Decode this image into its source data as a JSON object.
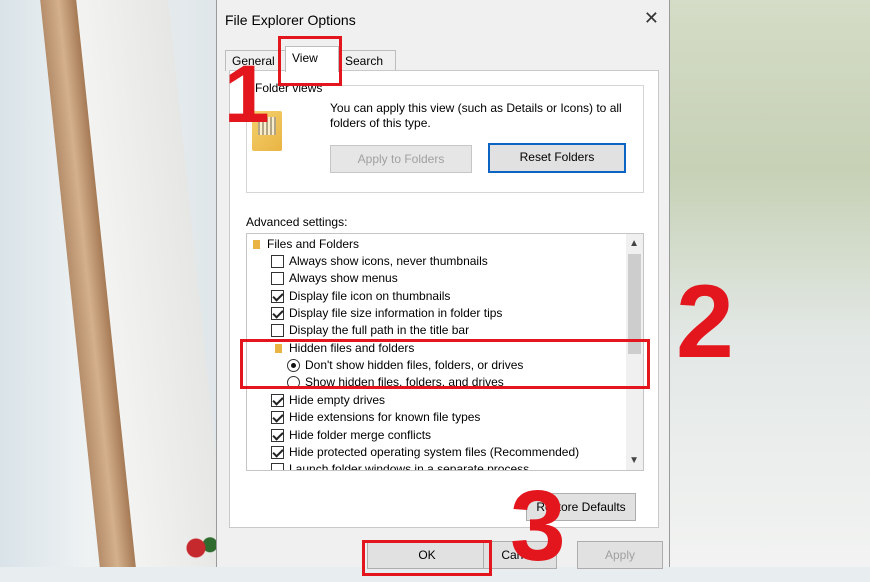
{
  "window": {
    "title": "File Explorer Options",
    "close_symbol": "✕"
  },
  "tabs": [
    {
      "label": "General"
    },
    {
      "label": "View"
    },
    {
      "label": "Search"
    }
  ],
  "folder_views": {
    "heading": "Folder views",
    "description": "You can apply this view (such as Details or Icons) to all folders of this type.",
    "apply_button": "Apply to Folders",
    "reset_button": "Reset Folders"
  },
  "advanced": {
    "heading": "Advanced settings:",
    "items": [
      {
        "type": "folder",
        "label": "Files and Folders"
      },
      {
        "type": "checkbox",
        "checked": false,
        "label": "Always show icons, never thumbnails"
      },
      {
        "type": "checkbox",
        "checked": false,
        "label": "Always show menus"
      },
      {
        "type": "checkbox",
        "checked": true,
        "label": "Display file icon on thumbnails"
      },
      {
        "type": "checkbox",
        "checked": true,
        "label": "Display file size information in folder tips"
      },
      {
        "type": "checkbox",
        "checked": false,
        "label": "Display the full path in the title bar"
      },
      {
        "type": "folder",
        "label": "Hidden files and folders"
      },
      {
        "type": "radio",
        "checked": true,
        "label": "Don't show hidden files, folders, or drives"
      },
      {
        "type": "radio",
        "checked": false,
        "label": "Show hidden files, folders, and drives"
      },
      {
        "type": "checkbox",
        "checked": true,
        "label": "Hide empty drives"
      },
      {
        "type": "checkbox",
        "checked": true,
        "label": "Hide extensions for known file types"
      },
      {
        "type": "checkbox",
        "checked": true,
        "label": "Hide folder merge conflicts"
      },
      {
        "type": "checkbox",
        "checked": true,
        "label": "Hide protected operating system files (Recommended)"
      },
      {
        "type": "checkbox",
        "checked": false,
        "label": "Launch folder windows in a separate process"
      }
    ]
  },
  "buttons": {
    "restore_defaults": "Restore Defaults",
    "ok": "OK",
    "cancel": "Cancel",
    "apply": "Apply"
  },
  "annotations": {
    "step1": "1",
    "step2": "2",
    "step3": "3"
  },
  "colors": {
    "annotation_red": "#e3161d",
    "focus_blue": "#0b63c4"
  }
}
